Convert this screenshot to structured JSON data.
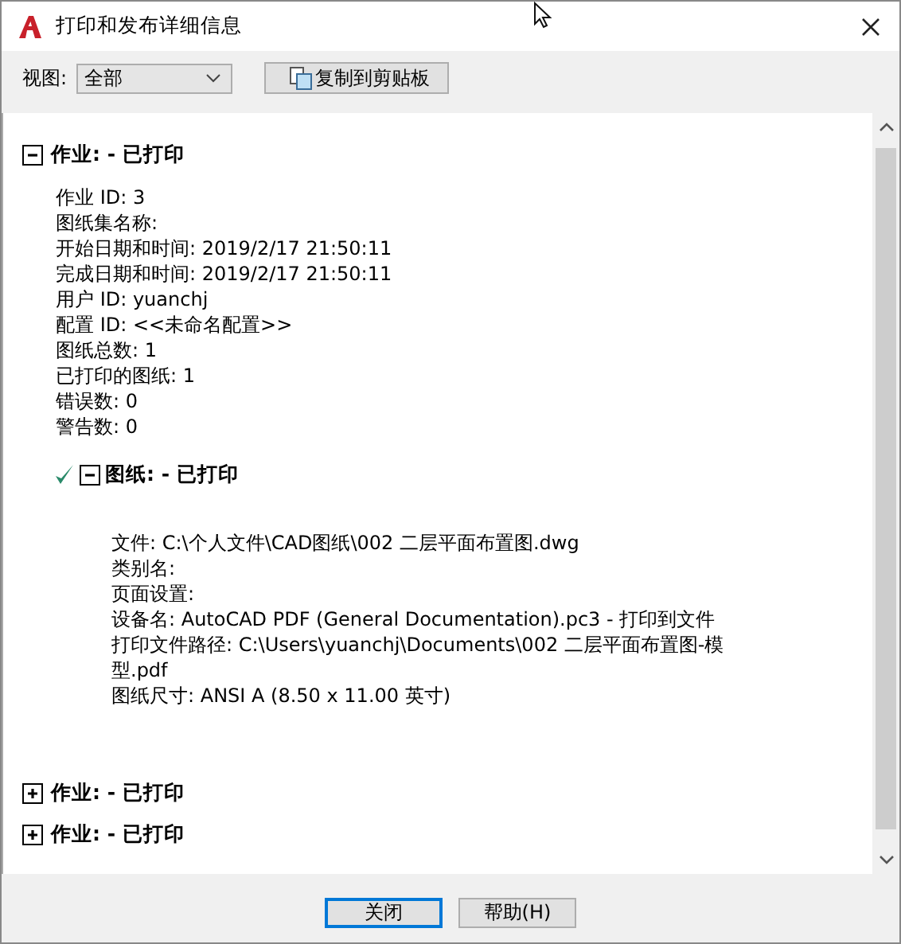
{
  "window": {
    "title": "打印和发布详细信息"
  },
  "view": {
    "label": "视图:",
    "value": "全部"
  },
  "copy_button": "复制到剪贴板",
  "jobs": [
    {
      "title": "作业: - 已打印",
      "expanded": true,
      "details": [
        "作业 ID: 3",
        "图纸集名称:",
        "开始日期和时间: 2019/2/17 21:50:11",
        "完成日期和时间: 2019/2/17 21:50:11",
        "用户 ID: yuanchj",
        "配置 ID: <<未命名配置>>",
        "图纸总数: 1",
        "已打印的图纸: 1",
        "错误数: 0",
        "警告数: 0"
      ],
      "sheets": [
        {
          "title": "图纸: - 已打印",
          "expanded": true,
          "succeeded": true,
          "details": [
            "文件: C:\\个人文件\\CAD图纸\\002 二层平面布置图.dwg",
            "类别名:",
            "页面设置:",
            "设备名: AutoCAD PDF (General Documentation).pc3 - 打印到文件",
            "打印文件路径: C:\\Users\\yuanchj\\Documents\\002 二层平面布置图-模型.pdf",
            "图纸尺寸: ANSI A (8.50 x 11.00 英寸)"
          ]
        }
      ]
    },
    {
      "title": "作业: - 已打印",
      "expanded": false
    },
    {
      "title": "作业: - 已打印",
      "expanded": false
    }
  ],
  "buttons": [
    {
      "label": "关闭",
      "selected": true
    },
    {
      "label": "帮助(H)",
      "selected": false
    }
  ]
}
